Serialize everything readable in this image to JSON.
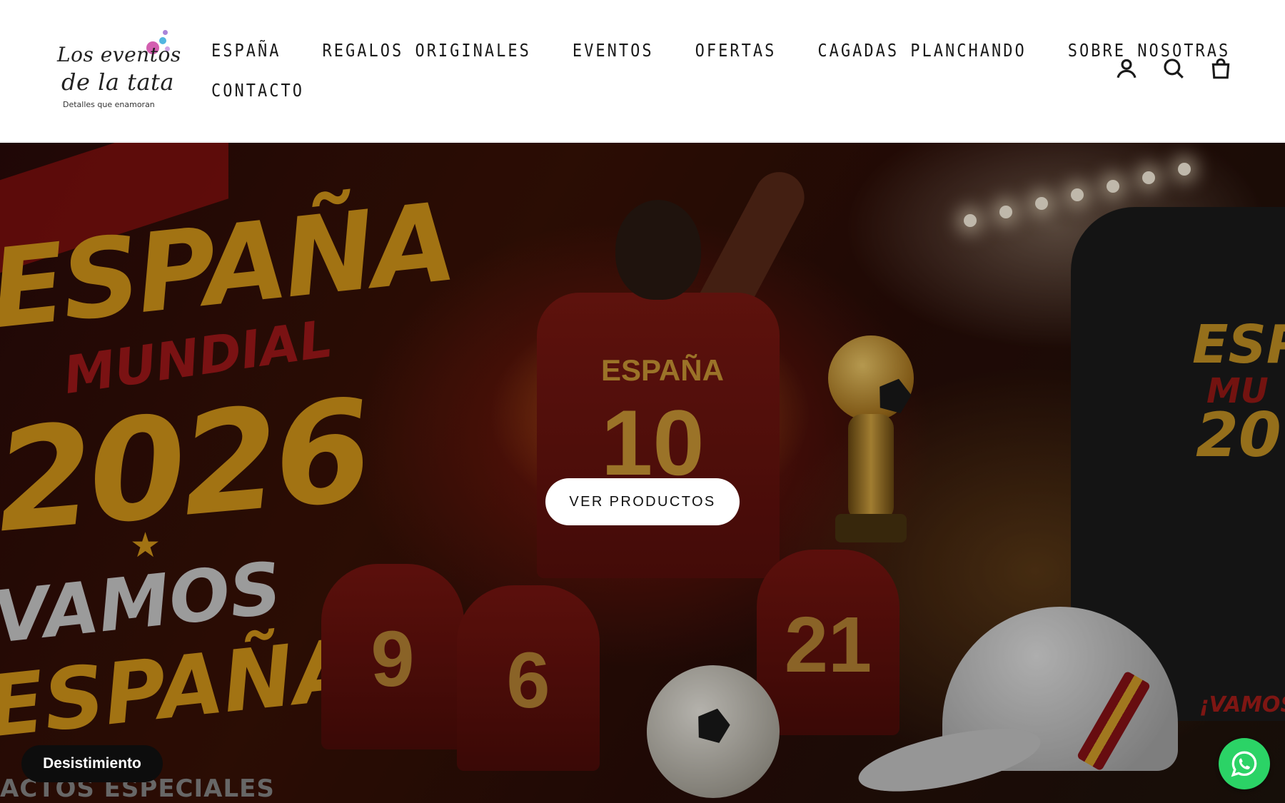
{
  "brand": {
    "line1": "Los eventos",
    "line2": "de la tata",
    "tagline": "Detalles que enamoran",
    "dot_colors": [
      "#d35fb0",
      "#52b6e0",
      "#a984d9",
      "#d0a3e6"
    ]
  },
  "nav": {
    "items": [
      {
        "label": "ESPAÑA"
      },
      {
        "label": "REGALOS ORIGINALES"
      },
      {
        "label": "EVENTOS"
      },
      {
        "label": "OFERTAS"
      },
      {
        "label": "CAGADAS PLANCHANDO"
      },
      {
        "label": "SOBRE NOSOTRAS"
      },
      {
        "label": "CONTACTO"
      }
    ]
  },
  "header_icons": [
    "account-icon",
    "search-icon",
    "cart-icon"
  ],
  "hero": {
    "banner_text": {
      "title": "ESPAÑA",
      "subtitle": "MUNDIAL",
      "year": "2026",
      "slogan_1": "VAMOS",
      "slogan_2": "ESPAÑA!",
      "footer_text": "ACTOS ESPECIALES",
      "shirt_name": "ESPAÑA",
      "shirt_number": "10",
      "numbers": [
        "9",
        "6",
        "21"
      ],
      "tshirt_text_1": "ESP",
      "tshirt_text_2": "MU",
      "tshirt_text_3": "20",
      "tshirt_text_4": "¡VAMOS"
    },
    "cta_label": "VER PRODUCTOS",
    "accent_colors": {
      "gold": "#d99a1a",
      "red": "#a3181a"
    }
  },
  "badge": {
    "label": "Desistimiento"
  },
  "whatsapp": {
    "icon": "whatsapp-icon",
    "color": "#2bd366"
  }
}
